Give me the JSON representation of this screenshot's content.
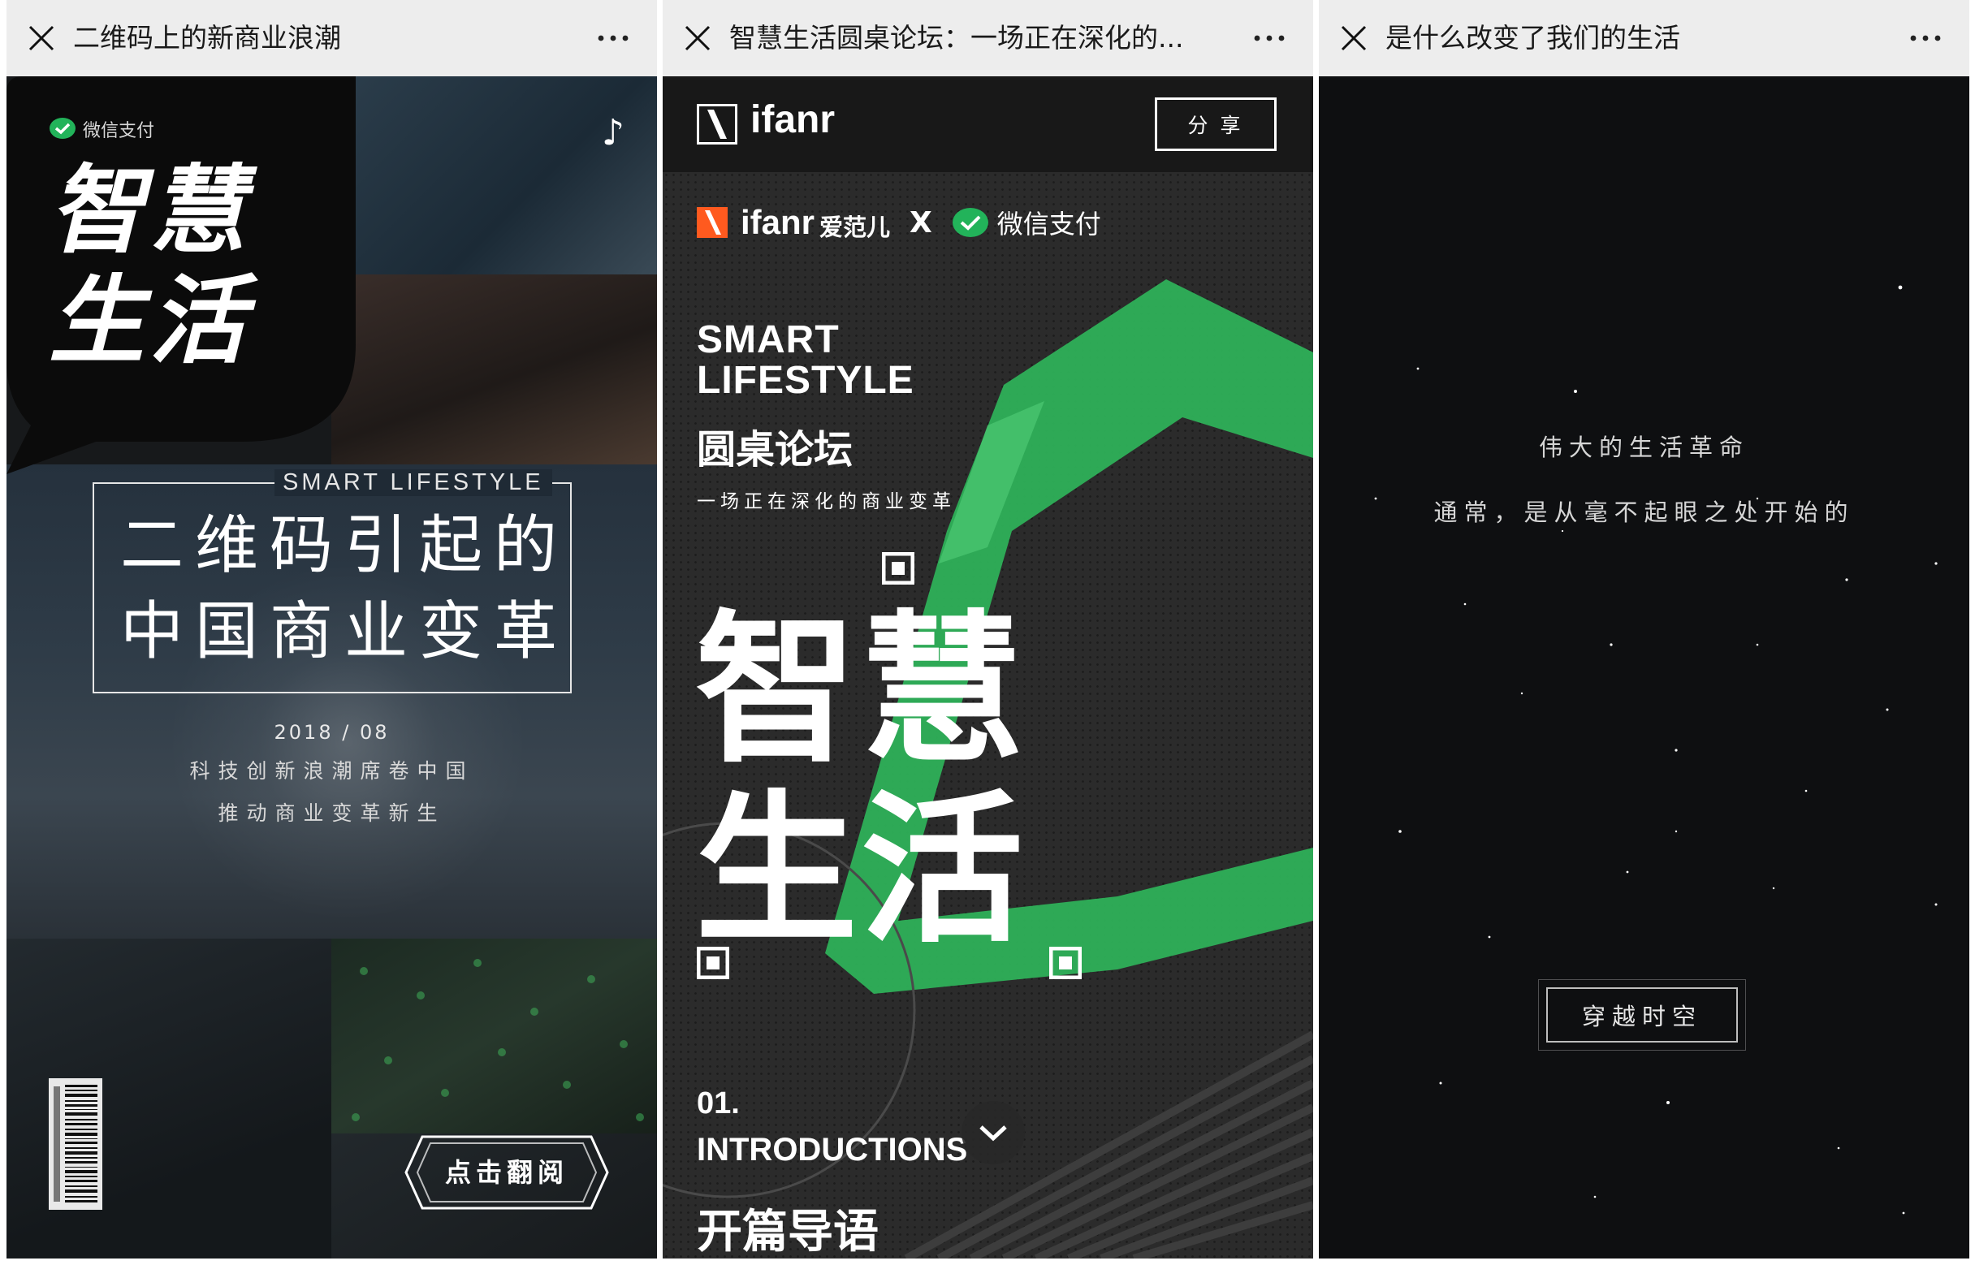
{
  "panels": [
    {
      "nav_title": "二维码上的新商业浪潮",
      "brand_label": "微信支付",
      "hero_calligraphy": [
        "智慧",
        "生活"
      ],
      "smart_lifestyle": "SMART  LIFESTYLE",
      "headline": [
        "二维码引起的",
        "中国商业变革"
      ],
      "date": "2018 / 08",
      "sub_lines": [
        "科技创新浪潮席卷中国",
        "推动商业变革新生"
      ],
      "cta_label": "点击翻阅",
      "icons": [
        "close-icon",
        "more-icon",
        "music-note-icon",
        "wechat-pay-icon",
        "barcode-icon"
      ]
    },
    {
      "nav_title": "智慧生活圆桌论坛：一场正在深化的...",
      "logo_word": "ifanr",
      "share_label": "分 享",
      "cobrand": {
        "ifanr": "ifanr",
        "ifanr_cn": "爱范儿",
        "x": "X",
        "wechat": "微信支付"
      },
      "smart_lines": [
        "SMART",
        "LIFESTYLE"
      ],
      "roundtable": "圆桌论坛",
      "tagline": "一场正在深化的商业变革",
      "big_title": [
        "智慧",
        "生活"
      ],
      "section_number": "01.",
      "section_title": "INTRODUCTIONS",
      "section_title_cn": "开篇导语",
      "icons": [
        "close-icon",
        "more-icon",
        "ifanr-logo-icon",
        "wechat-pay-icon",
        "chevron-down-icon"
      ],
      "accent_color": "#2fb45a"
    },
    {
      "nav_title": "是什么改变了我们的生活",
      "lines": [
        "伟大的生活革命",
        "通常，是从毫不起眼之处开始的"
      ],
      "button_label": "穿越时空",
      "icons": [
        "close-icon",
        "more-icon"
      ]
    }
  ]
}
